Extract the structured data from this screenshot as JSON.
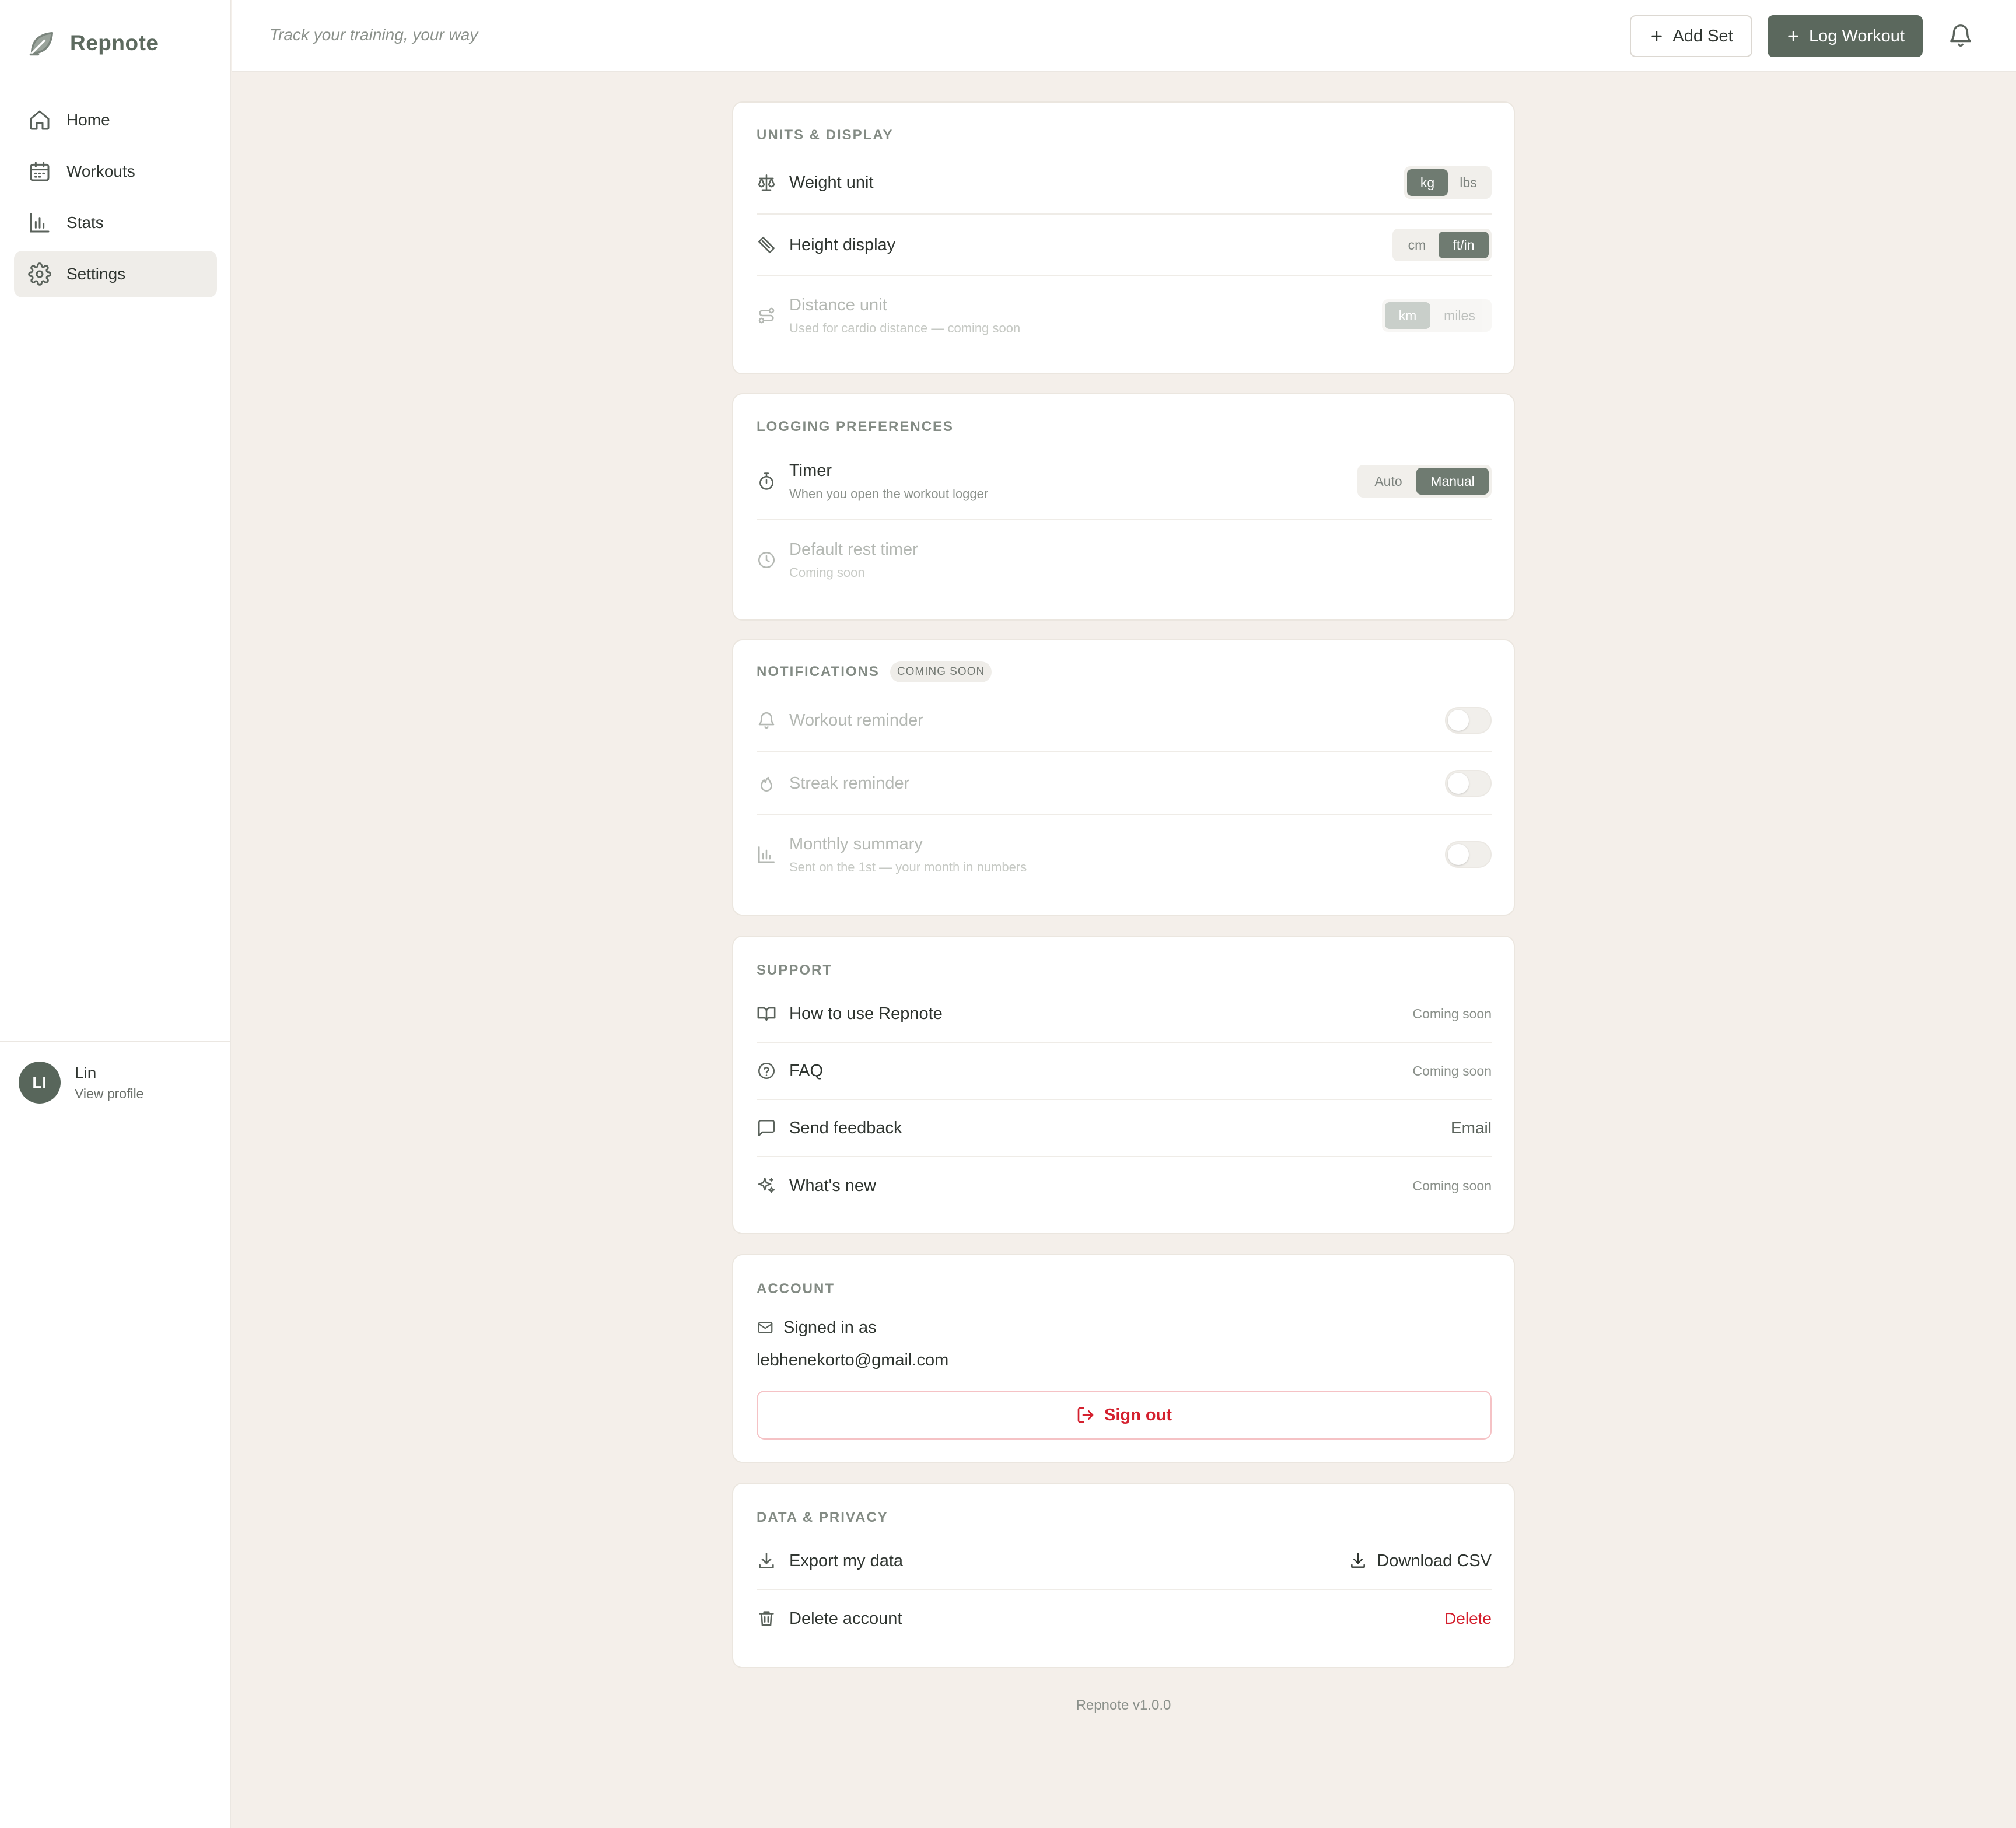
{
  "app": {
    "name": "Repnote",
    "tagline": "Track your training, your way",
    "version": "Repnote v1.0.0"
  },
  "colors": {
    "accent": "#5b685d",
    "danger": "#d4202e",
    "background": "#f4efea"
  },
  "sidebar": {
    "items": [
      {
        "label": "Home",
        "icon": "home-icon"
      },
      {
        "label": "Workouts",
        "icon": "calendar-icon"
      },
      {
        "label": "Stats",
        "icon": "bar-chart-icon"
      },
      {
        "label": "Settings",
        "icon": "gear-icon",
        "active": true
      }
    ],
    "profile": {
      "initials": "LI",
      "name": "Lin",
      "link": "View profile"
    }
  },
  "topbar": {
    "add_set_label": "Add Set",
    "log_workout_label": "Log Workout"
  },
  "units": {
    "title": "UNITS & DISPLAY",
    "weight": {
      "label": "Weight unit",
      "options": [
        "kg",
        "lbs"
      ],
      "selected": "kg"
    },
    "height": {
      "label": "Height display",
      "options": [
        "cm",
        "ft/in"
      ],
      "selected": "ft/in"
    },
    "distance": {
      "label": "Distance unit",
      "sub": "Used for cardio distance — coming soon",
      "options": [
        "km",
        "miles"
      ],
      "selected": "km",
      "disabled": true
    }
  },
  "logging": {
    "title": "LOGGING PREFERENCES",
    "timer": {
      "label": "Timer",
      "sub": "When you open the workout logger",
      "options": [
        "Auto",
        "Manual"
      ],
      "selected": "Manual"
    },
    "rest": {
      "label": "Default rest timer",
      "sub": "Coming soon",
      "disabled": true
    }
  },
  "notifications": {
    "title": "NOTIFICATIONS",
    "badge": "COMING SOON",
    "workout": {
      "label": "Workout reminder",
      "on": false
    },
    "streak": {
      "label": "Streak reminder",
      "on": false
    },
    "monthly": {
      "label": "Monthly summary",
      "sub": "Sent on the 1st — your month in numbers",
      "on": false
    }
  },
  "support": {
    "title": "SUPPORT",
    "howto": {
      "label": "How to use Repnote",
      "status": "Coming soon"
    },
    "faq": {
      "label": "FAQ",
      "status": "Coming soon"
    },
    "feedback": {
      "label": "Send feedback",
      "action": "Email"
    },
    "whatsnew": {
      "label": "What's new",
      "status": "Coming soon"
    }
  },
  "account": {
    "title": "ACCOUNT",
    "signed_in_label": "Signed in as",
    "email": "lebhenekorto@gmail.com",
    "sign_out_label": "Sign out"
  },
  "privacy": {
    "title": "DATA & PRIVACY",
    "export": {
      "label": "Export my data",
      "action": "Download CSV"
    },
    "delete": {
      "label": "Delete account",
      "action": "Delete"
    }
  }
}
